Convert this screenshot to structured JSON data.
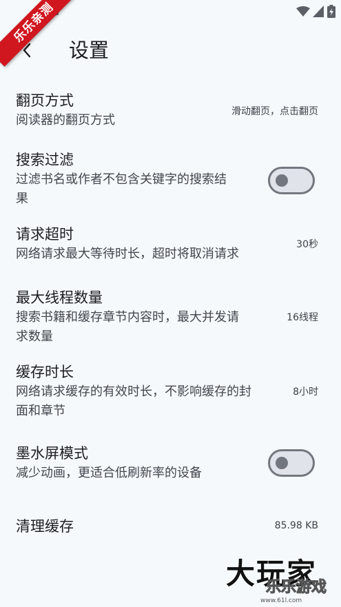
{
  "status_bar": {
    "icons": [
      "notification-icon",
      "wifi-icon",
      "signal-icon",
      "battery-charging-icon"
    ]
  },
  "ribbon": {
    "text": "乐乐亲测"
  },
  "app_bar": {
    "back_icon": "chevron-left-icon",
    "title": "设置"
  },
  "settings": {
    "page_turn": {
      "title": "翻页方式",
      "desc": "阅读器的翻页方式",
      "value": "滑动翻页，点击翻页"
    },
    "search_filter": {
      "title": "搜索过滤",
      "desc_line1": "过滤书名或作者不包含关键字的搜索结",
      "desc_line2": "果",
      "toggle_on": false
    },
    "request_timeout": {
      "title": "请求超时",
      "desc": "网络请求最大等待时长，超时将取消请求",
      "value": "30秒"
    },
    "max_threads": {
      "title": "最大线程数量",
      "desc_line1": "搜索书籍和缓存章节内容时，最大并发请",
      "desc_line2": "求数量",
      "value": "16线程"
    },
    "cache_duration": {
      "title": "缓存时长",
      "desc_line1": "网络请求缓存的有效时长，不影响缓存的封",
      "desc_line2": "面和章节",
      "value": "8小时"
    },
    "eink_mode": {
      "title": "墨水屏模式",
      "desc": "减少动画，更适合低刷新率的设备",
      "toggle_on": false
    },
    "clear_cache": {
      "title": "清理缓存",
      "value": "85.98 KB"
    }
  },
  "watermark": {
    "main": "大玩家",
    "sub": "乐乐游戏",
    "url": "www.61l.com"
  },
  "colors": {
    "background": "#f5f9fc",
    "ribbon": "#d0161e",
    "toggle_track": "#e0e3e9",
    "toggle_outline": "#72777f"
  }
}
